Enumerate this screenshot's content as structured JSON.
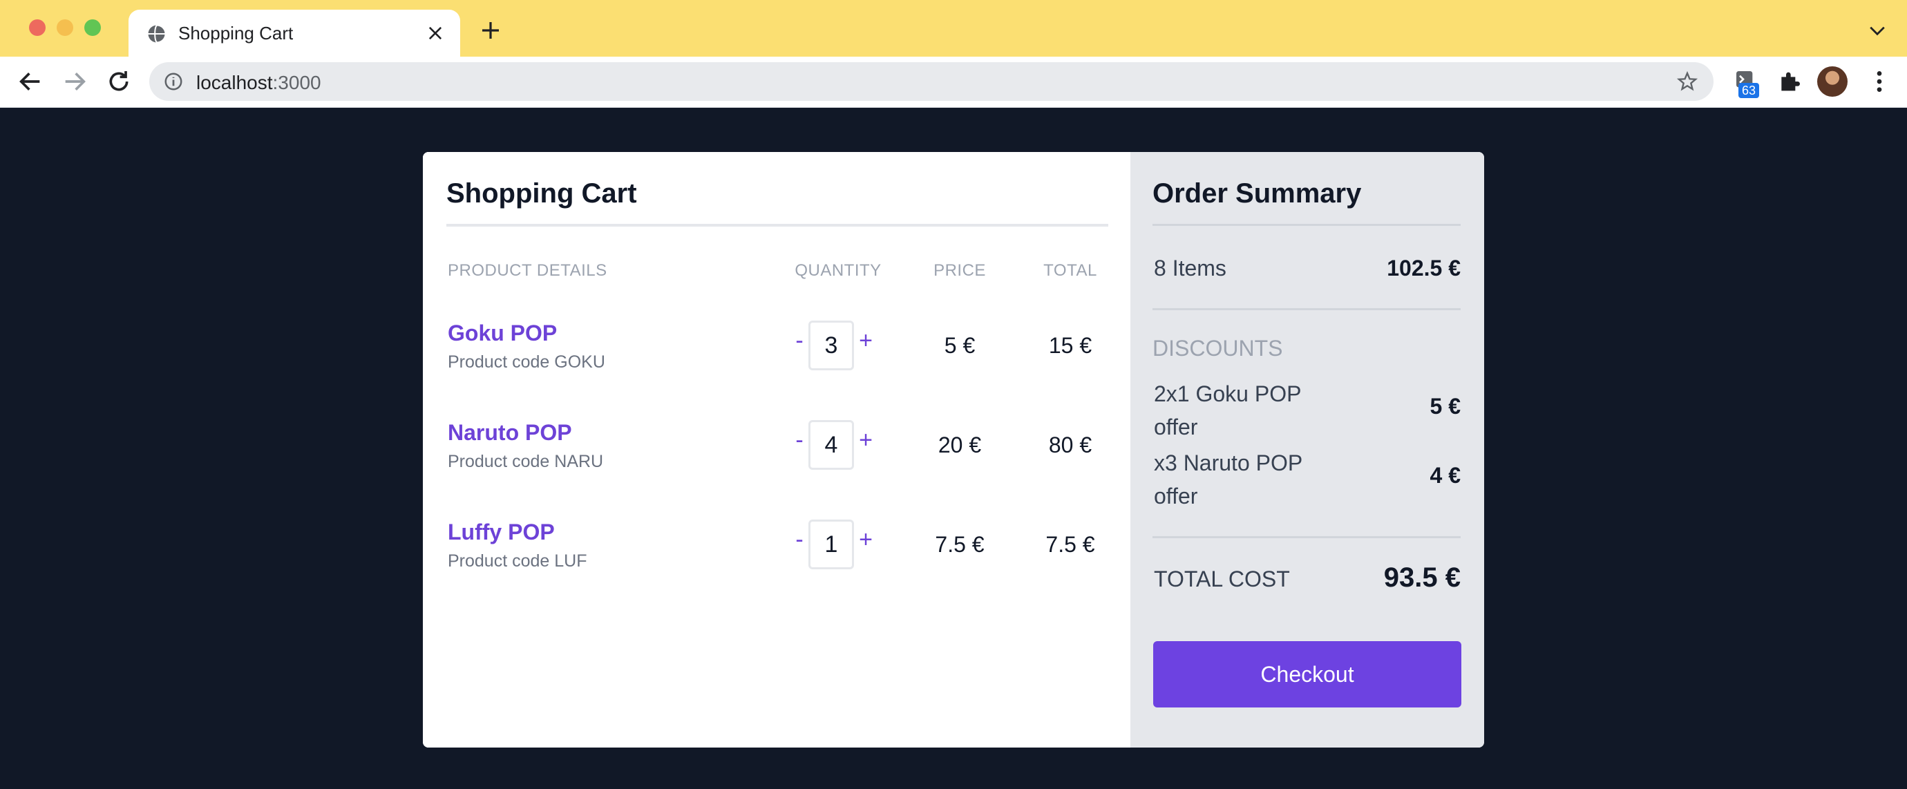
{
  "browser": {
    "tab_title": "Shopping Cart",
    "url_host": "localhost",
    "url_port": ":3000",
    "extension_badge": "63",
    "icons": [
      "globe-icon",
      "close-icon",
      "plus-icon",
      "chevron-down-icon",
      "back-arrow-icon",
      "forward-arrow-icon",
      "reload-icon",
      "info-icon",
      "star-icon",
      "terminal-icon",
      "puzzle-icon",
      "avatar",
      "kebab-menu-icon"
    ]
  },
  "cart": {
    "title": "Shopping Cart",
    "columns": {
      "product": "PRODUCT DETAILS",
      "quantity": "QUANTITY",
      "price": "PRICE",
      "total": "TOTAL"
    },
    "decrement_label": "-",
    "increment_label": "+",
    "products": [
      {
        "name": "Goku POP",
        "code": "Product code GOKU",
        "quantity": "3",
        "price": "5 €",
        "total": "15 €"
      },
      {
        "name": "Naruto POP",
        "code": "Product code NARU",
        "quantity": "4",
        "price": "20 €",
        "total": "80 €"
      },
      {
        "name": "Luffy POP",
        "code": "Product code LUF",
        "quantity": "1",
        "price": "7.5 €",
        "total": "7.5 €"
      }
    ]
  },
  "summary": {
    "title": "Order Summary",
    "items_label": "8 Items",
    "items_total": "102.5 €",
    "discounts_heading": "DISCOUNTS",
    "discounts": [
      {
        "name": "2x1 Goku POP offer",
        "amount": "5 €"
      },
      {
        "name": "x3 Naruto POP offer",
        "amount": "4 €"
      }
    ],
    "total_cost_label": "TOTAL COST",
    "total_cost": "93.5 €",
    "checkout_label": "Checkout"
  },
  "colors": {
    "page_background": "#111827",
    "accent": "#6d42d7",
    "checkout_button": "#6d42e1",
    "summary_panel": "#e5e7eb",
    "tab_strip": "#fbdf72"
  }
}
